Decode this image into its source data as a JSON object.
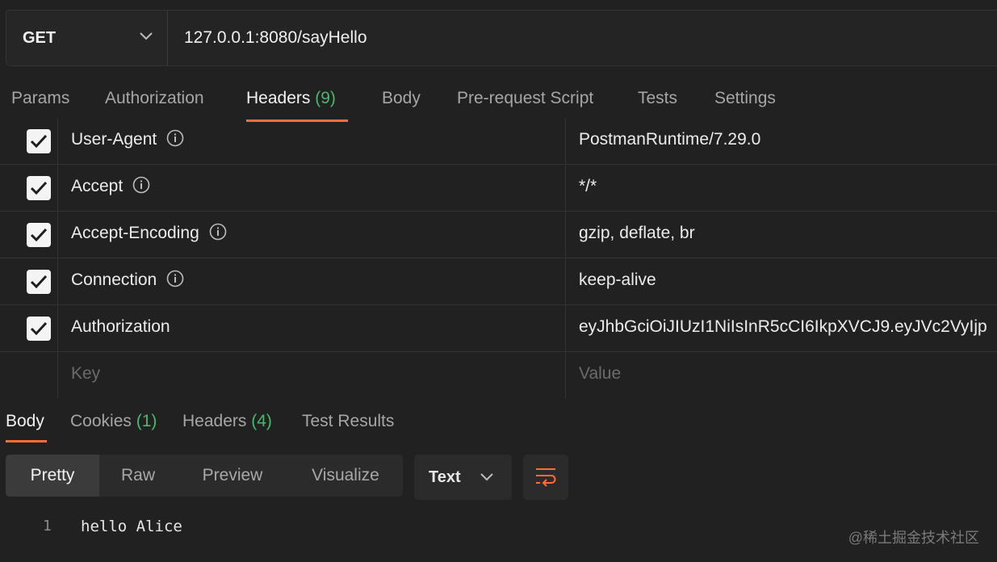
{
  "request": {
    "method": "GET",
    "url": "127.0.0.1:8080/sayHello"
  },
  "request_tabs": [
    {
      "label": "Params"
    },
    {
      "label": "Authorization"
    },
    {
      "label": "Headers",
      "count": "(9)"
    },
    {
      "label": "Body"
    },
    {
      "label": "Pre-request Script"
    },
    {
      "label": "Tests"
    },
    {
      "label": "Settings"
    }
  ],
  "headers": [
    {
      "key": "User-Agent",
      "value": "PostmanRuntime/7.29.0",
      "checked": true,
      "info": true
    },
    {
      "key": "Accept",
      "value": "*/*",
      "checked": true,
      "info": true
    },
    {
      "key": "Accept-Encoding",
      "value": "gzip, deflate, br",
      "checked": true,
      "info": true
    },
    {
      "key": "Connection",
      "value": "keep-alive",
      "checked": true,
      "info": true
    },
    {
      "key": "Authorization",
      "value": "eyJhbGciOiJIUzI1NiIsInR5cCI6IkpXVCJ9.eyJVc2VyIjp",
      "checked": true,
      "info": false
    }
  ],
  "new_row": {
    "key_placeholder": "Key",
    "value_placeholder": "Value"
  },
  "response_tabs": [
    {
      "label": "Body"
    },
    {
      "label": "Cookies",
      "count": "(1)"
    },
    {
      "label": "Headers",
      "count": "(4)"
    },
    {
      "label": "Test Results"
    }
  ],
  "view_modes": [
    "Pretty",
    "Raw",
    "Preview",
    "Visualize"
  ],
  "format": "Text",
  "response_body": {
    "line_number": "1",
    "text": "hello Alice"
  },
  "watermark": "@稀土掘金技术社区",
  "colors": {
    "accent": "#ff6c37",
    "count_green": "#49b86f",
    "background": "#212121"
  },
  "icons": [
    "chevron-down-icon",
    "info-icon",
    "checkmark-icon",
    "wrap-lines-icon"
  ]
}
